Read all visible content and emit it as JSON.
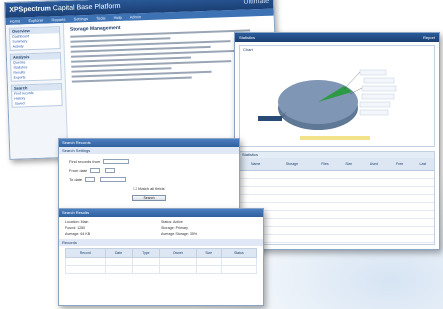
{
  "main_window": {
    "title": "XPSpectrum",
    "subtitle": "Capital Base Platform",
    "brand": "Ultimate",
    "menu": [
      "Home",
      "Explorer",
      "Reports",
      "Settings",
      "Tools",
      "Help",
      "Admin"
    ],
    "nav": [
      {
        "header": "Overview",
        "items": [
          "Dashboard",
          "Summary",
          "Activity"
        ]
      },
      {
        "header": "Analysis",
        "items": [
          "Queries",
          "Statistics",
          "Results",
          "Exports"
        ]
      },
      {
        "header": "Search",
        "items": [
          "Find records",
          "History",
          "Saved"
        ]
      }
    ],
    "heading": "Storage Management"
  },
  "chart_window": {
    "title": "Statistics",
    "right_label": "Report",
    "panel_label": "Chart",
    "table_label": "Statistics",
    "columns": [
      "Name",
      "Storage",
      "Files",
      "Size",
      "Used",
      "Free",
      "Last"
    ],
    "rows": 11
  },
  "search_dialog": {
    "title": "Search Records",
    "section": "Search Settings",
    "row1": "Find records from",
    "row2": "From date",
    "row3": "To date",
    "row4": "Match all fields",
    "button": "Search"
  },
  "result_dialog": {
    "title": "Search Results",
    "fields": [
      "Location: Main",
      "Status: Active",
      "Found: 1280",
      "Storage: Primary",
      "Average: 64 KB",
      "Average Storage: 35%"
    ],
    "section": "Records",
    "columns": [
      "Record",
      "Date",
      "Type",
      "Owner",
      "Size",
      "Status"
    ]
  },
  "colors": {
    "titlebar": "#1b3f74",
    "pie_main": "#7f96b4",
    "pie_slice": "#2e9a46",
    "accent": "#3d72b5"
  }
}
